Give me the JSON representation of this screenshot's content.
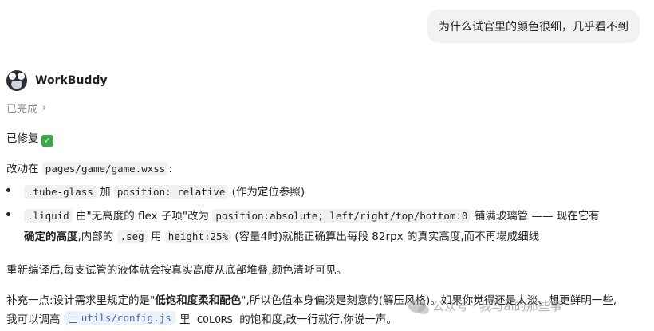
{
  "user_message": "为什么试官里的颜色很细，几乎看不到",
  "agent": {
    "name": "WorkBuddy",
    "status": "已完成"
  },
  "reply": {
    "fixed": "已修复",
    "changed_in_prefix": "改动在",
    "changed_file": "pages/game/game.wxss",
    "changed_suffix": ":",
    "bullet1": {
      "code1": ".tube-glass",
      "t1": "加",
      "code2": "position: relative",
      "t2": "(作为定位参照)"
    },
    "bullet2": {
      "code1": ".liquid",
      "t1": "由\"无高度的 flex 子项\"改为",
      "code2": "position:absolute; left/right/top/bottom:0",
      "t2": "铺满玻璃管 —— 现在它有",
      "bold": "确定的高度",
      "t3": ",内部的",
      "code3": ".seg",
      "t4": "用",
      "code4": "height:25%",
      "t5": "(容量4时)就能正确算出每段 82rpx 的真实高度,而不再塌成细线"
    },
    "para1": "重新编译后,每支试管的液体就会按真实高度从底部堆叠,颜色清晰可见。",
    "para2": {
      "t1": "补充一点:设计需求里规定的是\"",
      "bold": "低饱和度柔和配色",
      "t2": "\",所以色值本身偏淡是刻意的(解压风格)。如果你觉得还是太淡、想更鲜明一些,",
      "t3": "我可以调高",
      "file": "utils/config.js",
      "t4": "里",
      "code": "COLORS",
      "t5": "的饱和度,改一行就行,你说一声。"
    }
  },
  "watermark": "公众号 · 我与ai的那些事"
}
